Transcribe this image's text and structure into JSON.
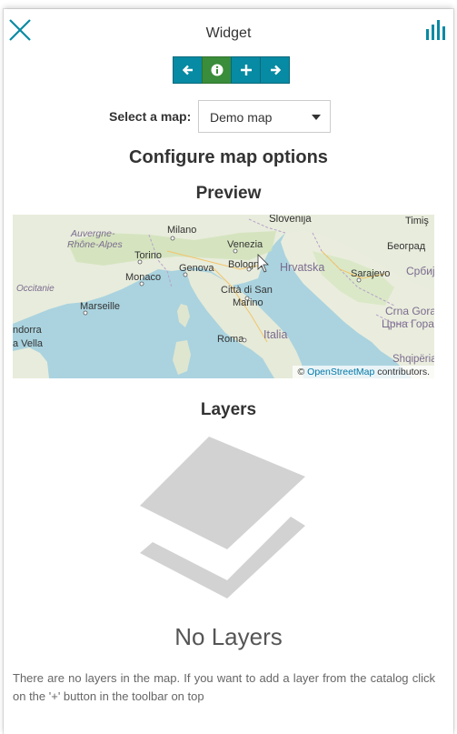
{
  "header": {
    "title": "Widget",
    "close_icon": "close-icon",
    "chart_icon": "bar-chart-icon"
  },
  "toolbar": {
    "buttons": [
      {
        "icon": "arrow-left-icon",
        "active": false
      },
      {
        "icon": "info-icon",
        "active": true
      },
      {
        "icon": "plus-icon",
        "active": false
      },
      {
        "icon": "arrow-right-icon",
        "active": false
      }
    ],
    "color": "#078aa3",
    "active_color": "#3a8d3a"
  },
  "map_select": {
    "label": "Select a map:",
    "value": "Demo map"
  },
  "headings": {
    "configure": "Configure map options",
    "preview": "Preview",
    "layers": "Layers"
  },
  "map": {
    "places": {
      "slovenija": "Slovenija",
      "timisoara": "Timiş",
      "auvergne": "Auvergne-",
      "rhone_alpes": "Rhône-Alpes",
      "milano": "Milano",
      "venezia": "Venezia",
      "beograd": "Београд",
      "torino": "Torino",
      "hrvatska": "Hrvatska",
      "genova": "Genova",
      "bologna": "Bologna",
      "monaco": "Monaco",
      "sarajevo": "Sarajevo",
      "srbija": "Србија",
      "occitanie": "Occitanie",
      "citta_san_marino": "Città di San",
      "marino": "Marino",
      "marseille": "Marseille",
      "crna_gora": "Crna Gora /",
      "crna_gora_cyr": "Црна Гора",
      "andorra": "ndorra",
      "vella": "a Vella",
      "roma": "Roma",
      "italia": "Italia",
      "shqiperia": "Shqipëria"
    },
    "attribution_prefix": "©",
    "attribution_link": "OpenStreetMap",
    "attribution_suffix": "contributors."
  },
  "empty_state": {
    "icon": "layers-stack-icon",
    "title": "No Layers",
    "description": "There are no layers in the map. If you want to add a layer from the catalog click on the '+' button in the toolbar on top"
  }
}
